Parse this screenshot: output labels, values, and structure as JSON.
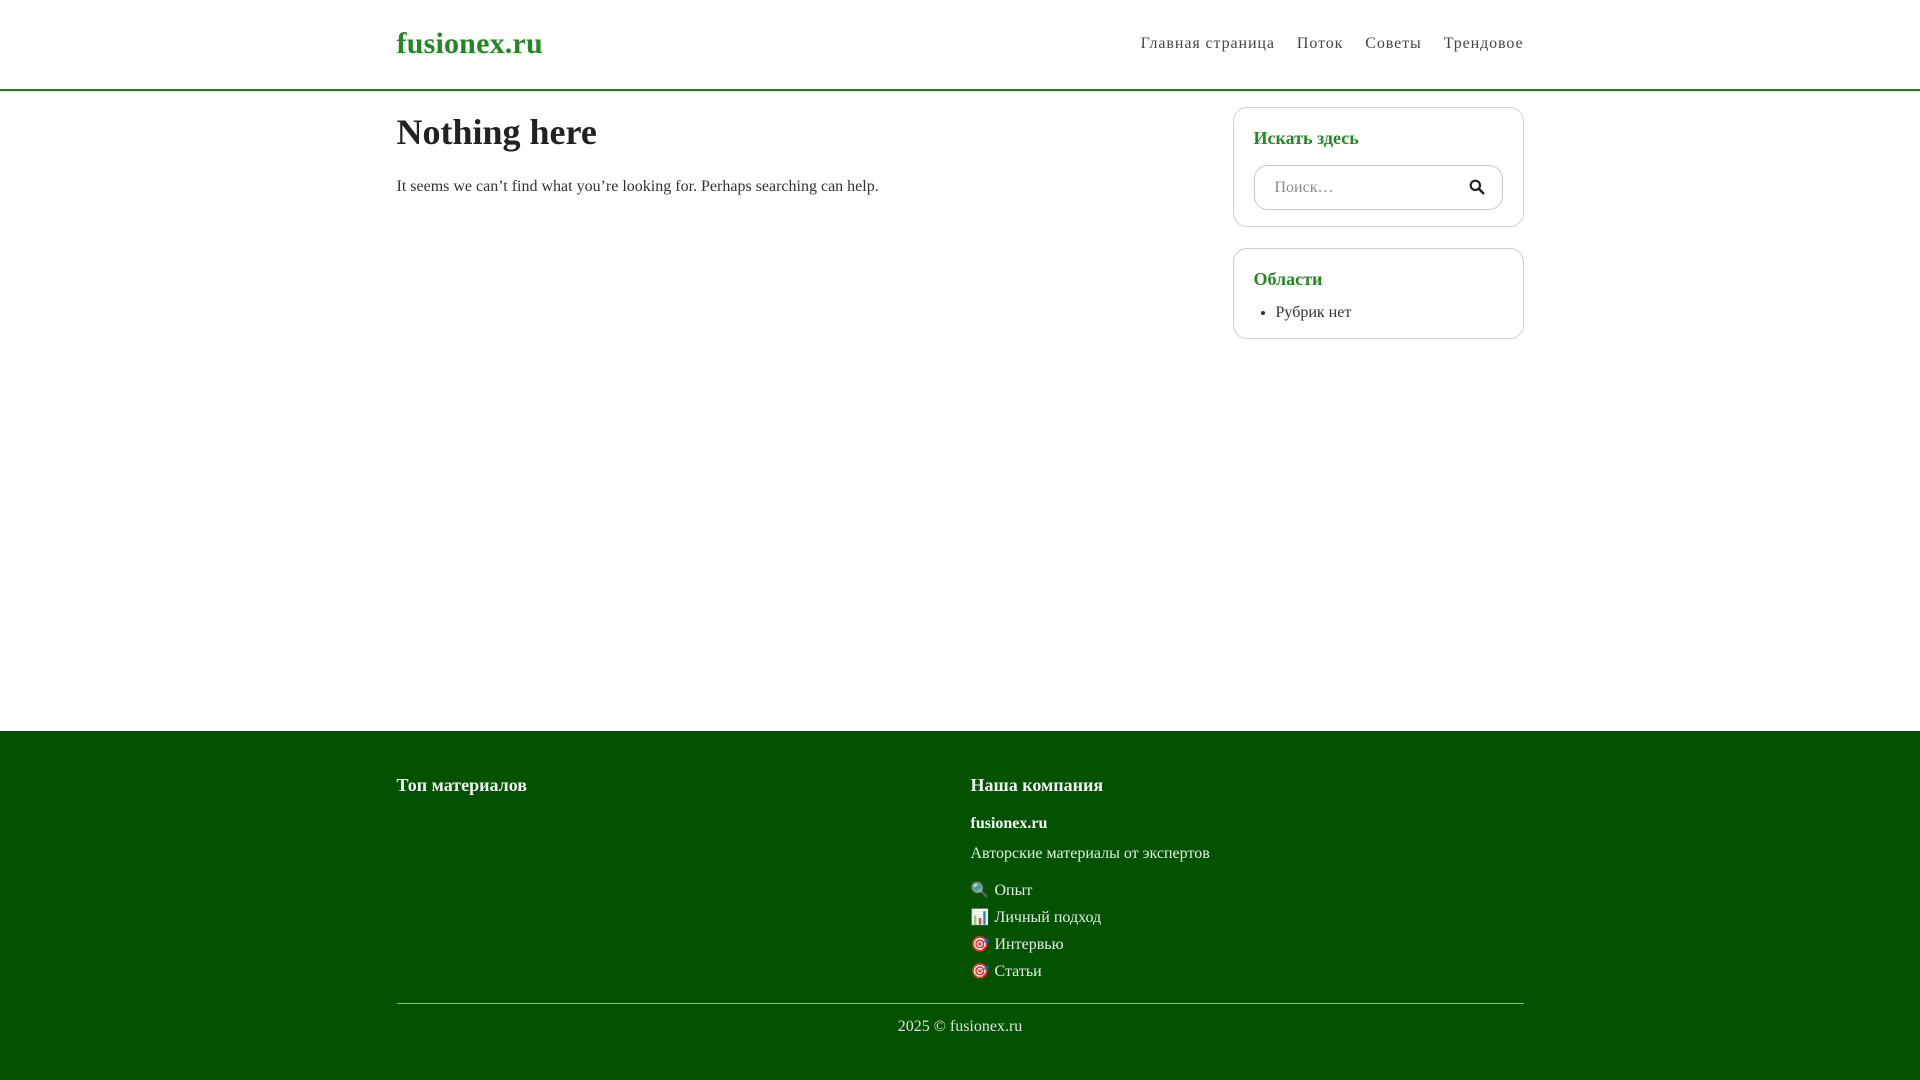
{
  "header": {
    "site_title": "fusionex.ru",
    "nav": [
      {
        "label": "Главная страница"
      },
      {
        "label": "Поток"
      },
      {
        "label": "Советы"
      },
      {
        "label": "Трендовое"
      }
    ]
  },
  "main": {
    "title": "Nothing here",
    "text": "It seems we can’t find what you’re looking for. Perhaps searching can help."
  },
  "sidebar": {
    "search_widget": {
      "title": "Искать здесь",
      "placeholder": "Поиск…",
      "button_icon": "search-icon"
    },
    "categories_widget": {
      "title": "Области",
      "items": [
        "Рубрик нет"
      ]
    }
  },
  "footer": {
    "left_title": "Топ материалов",
    "right_title": "Наша компания",
    "brand": "fusionex.ru",
    "tagline": "Авторские материалы от экспертов",
    "links": [
      {
        "emoji": "🔍",
        "label": "Опыт"
      },
      {
        "emoji": "📊",
        "label": "Личный подход"
      },
      {
        "emoji": "🎯",
        "label": "Интервью"
      },
      {
        "emoji": "🎯",
        "label": "Статьи"
      }
    ],
    "copyright": "2025 © fusionex.ru"
  },
  "colors": {
    "accent": "#1f8a1f",
    "footer_bg": "#025202"
  }
}
